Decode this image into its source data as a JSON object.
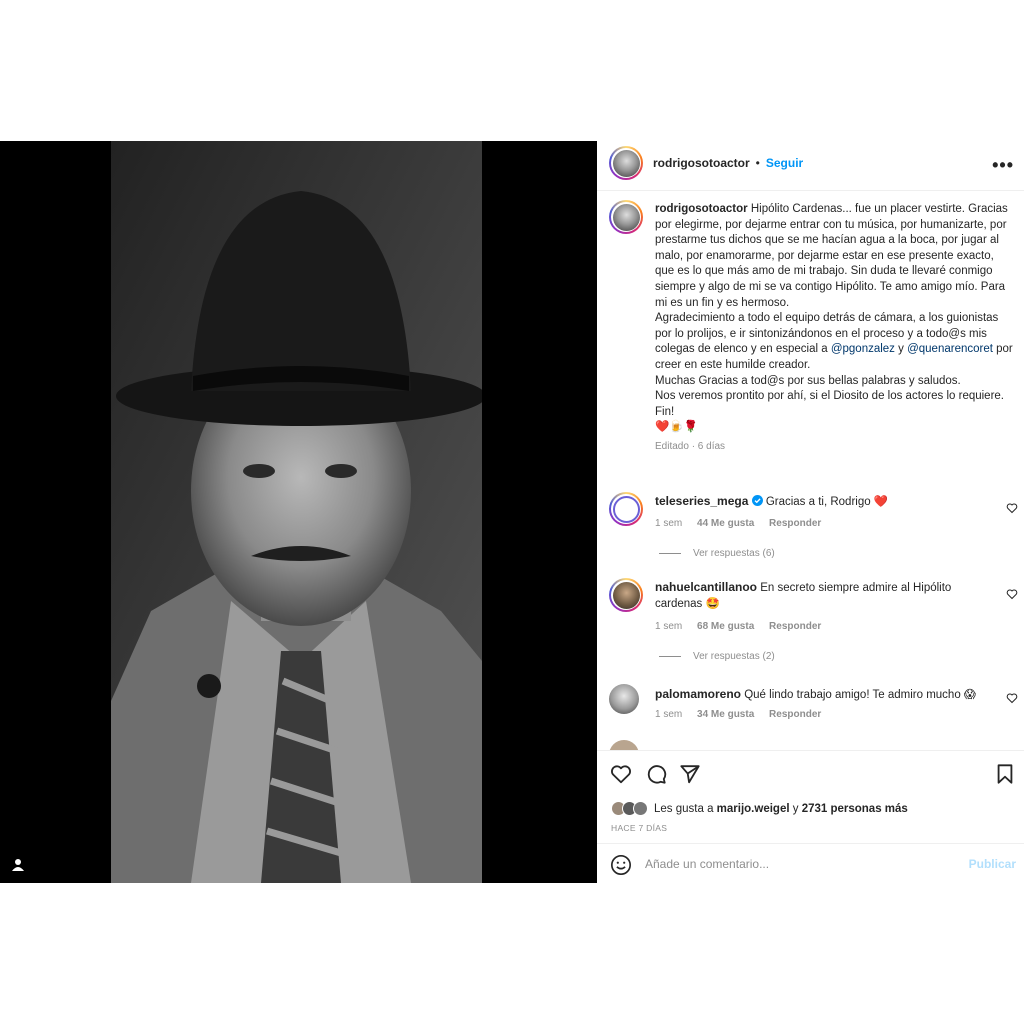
{
  "header": {
    "username": "rodrigosotoactor",
    "separator": "•",
    "follow_label": "Seguir",
    "more_label": "•••"
  },
  "caption": {
    "username": "rodrigosotoactor",
    "text_1": "Hipólito Cardenas... fue un placer vestirte. Gracias por elegirme, por dejarme entrar con tu música, por humanizarte, por prestarme tus dichos que se me hacían agua a la boca, por jugar al malo, por enamorarme, por dejarme estar en ese presente exacto, que es lo que más amo de mi trabajo. Sin duda te llevaré conmigo siempre y algo de mi se va contigo Hipólito. Te amo amigo mío. Para mi es un fin y es hermoso.",
    "text_2": "Agradecimiento a todo el equipo detrás de cámara, a los guionistas por lo prolijos, e ir sintonizándonos en el proceso y a todo@s mis colegas de elenco y en especial a",
    "mention_1": "@pgonzalez",
    "and_word": "y",
    "mention_2": "@quenarencoret",
    "text_3": "por creer en este humilde creador.",
    "text_4": "Muchas Gracias a tod@s por sus bellas palabras y saludos.",
    "text_5": "Nos veremos prontito por ahí, si el Diosito de los actores lo requiere.",
    "text_6": "Fin!",
    "emojis": "❤️🍺🌹",
    "meta": "Editado · 6 días"
  },
  "comments": [
    {
      "username": "teleseries_mega",
      "verified": true,
      "text": "Gracias a ti, Rodrigo",
      "emoji": "❤️",
      "time": "1 sem",
      "likes": "44 Me gusta",
      "reply": "Responder",
      "view_replies": "Ver respuestas (6)"
    },
    {
      "username": "nahuelcantillanoo",
      "text": "En secreto siempre admire al Hipólito cardenas",
      "emoji": "🤩",
      "time": "1 sem",
      "likes": "68 Me gusta",
      "reply": "Responder",
      "view_replies": "Ver respuestas (2)"
    },
    {
      "username": "palomamoreno",
      "text": "Qué lindo trabajo amigo! Te admiro mucho",
      "emoji": "😱",
      "time": "1 sem",
      "likes": "34 Me gusta",
      "reply": "Responder"
    }
  ],
  "actions": {
    "likes_prefix": "Les gusta a",
    "likes_user": "marijo.weigel",
    "likes_middle": "y",
    "likes_count": "2731 personas más",
    "timestamp": "HACE 7 DÍAS"
  },
  "add_comment": {
    "placeholder": "Añade un comentario...",
    "post_label": "Publicar"
  },
  "colors": {
    "accent_blue": "#0095f6",
    "mention": "#00376b",
    "muted": "#8e8e8e",
    "heart_red": "#ed4956"
  }
}
